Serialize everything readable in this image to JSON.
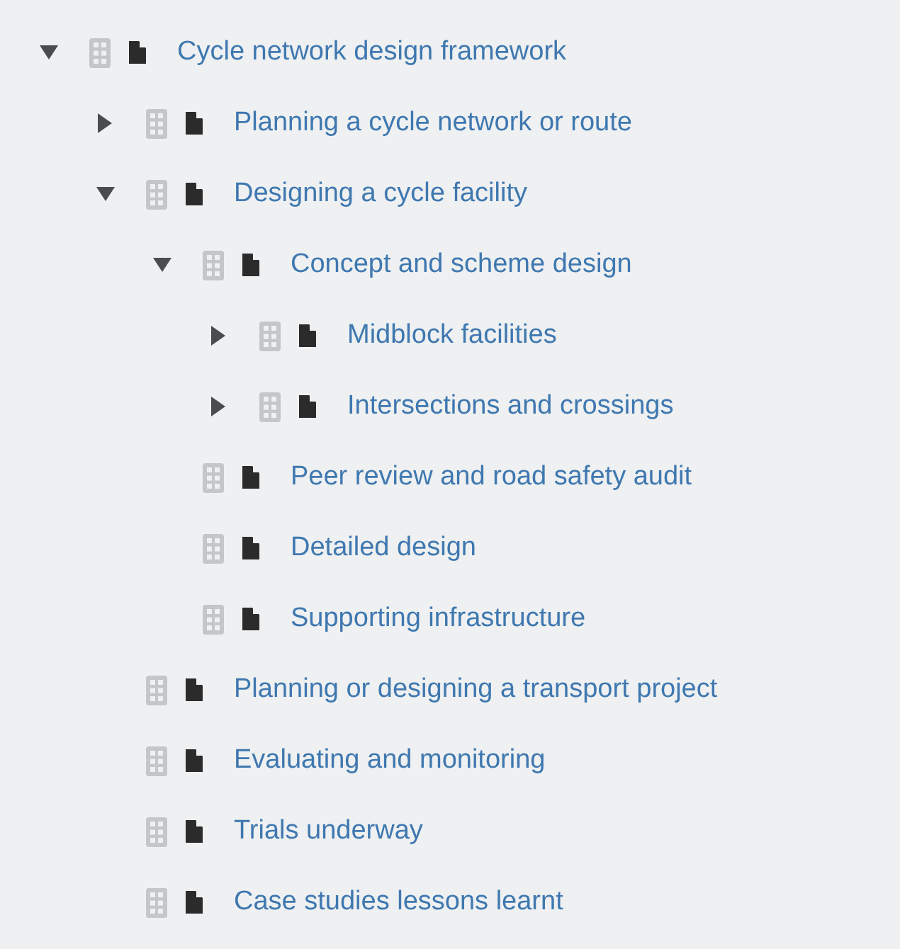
{
  "tree": [
    {
      "label": "Cycle network design framework",
      "expanded": true,
      "children": [
        {
          "label": "Planning a cycle network or route",
          "expanded": false
        },
        {
          "label": "Designing a cycle facility",
          "expanded": true,
          "children": [
            {
              "label": "Concept and scheme design",
              "expanded": true,
              "children": [
                {
                  "label": "Midblock facilities",
                  "expanded": false
                },
                {
                  "label": "Intersections and crossings",
                  "expanded": false
                }
              ]
            },
            {
              "label": "Peer review and road safety audit"
            },
            {
              "label": "Detailed design"
            },
            {
              "label": "Supporting infrastructure"
            }
          ]
        },
        {
          "label": "Planning or designing a transport project"
        },
        {
          "label": "Evaluating and monitoring"
        },
        {
          "label": "Trials underway"
        },
        {
          "label": "Case studies lessons learnt"
        }
      ]
    }
  ]
}
